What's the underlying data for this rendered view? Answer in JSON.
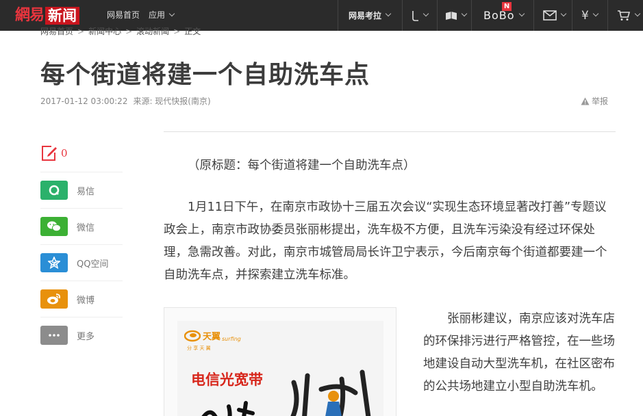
{
  "topbar": {
    "logo_brand": "網易",
    "logo_section": "新闻",
    "home": "网易首页",
    "apps": "应用",
    "kaola": "网易考拉",
    "bobo": "BoBo",
    "bobo_badge": "N",
    "icons": [
      "phone-icon",
      "reader-icon",
      "mail-icon",
      "money-icon",
      "cart-icon"
    ]
  },
  "breadcrumb": [
    "网易首页",
    "新闻中心",
    "滚动新闻",
    "正文"
  ],
  "article": {
    "title": "每个街道将建一个自助洗车点",
    "date": "2017-01-12 03:00:22",
    "source": "来源: 现代快报(南京)",
    "report": "举报",
    "paragraphs": [
      "（原标题：每个街道将建一个自助洗车点）",
      "1月11日下午，在南京市政协十三届五次会议“实现生态环境显著改打善”专题议政会上，南京市政协委员张丽彬提出，洗车极不方便，且洗车污染没有经过环保处理，急需改善。对此，南京市城管局局长许卫宁表示，今后南京每个街道都要建一个自助洗车点，并探索建立洗车标准。",
      "张丽彬建议，南京应该对洗车店的环保排污进行严格管控，在一些场地建设自动大型洗车机，在社区密布的公共场地建立小型自助洗车机。"
    ]
  },
  "share": {
    "comment_count": "0",
    "items": [
      {
        "label": "易信",
        "icon": "yixin-icon",
        "color": "#2bb16b"
      },
      {
        "label": "微信",
        "icon": "wechat-icon",
        "color": "#3cb034"
      },
      {
        "label": "QQ空间",
        "icon": "qzone-icon",
        "color": "#2a8ed6"
      },
      {
        "label": "微博",
        "icon": "weibo-icon",
        "color": "#e8910c"
      },
      {
        "label": "更多",
        "icon": "more-icon",
        "color": "#8c8c8c"
      }
    ]
  },
  "ad": {
    "brand": "天翼",
    "brand_en": "surfing",
    "tagline": "分 享 天 翼",
    "headline": "电信光宽带"
  },
  "colors": {
    "accent": "#e8353e",
    "topbar": "#2b2b2b"
  }
}
